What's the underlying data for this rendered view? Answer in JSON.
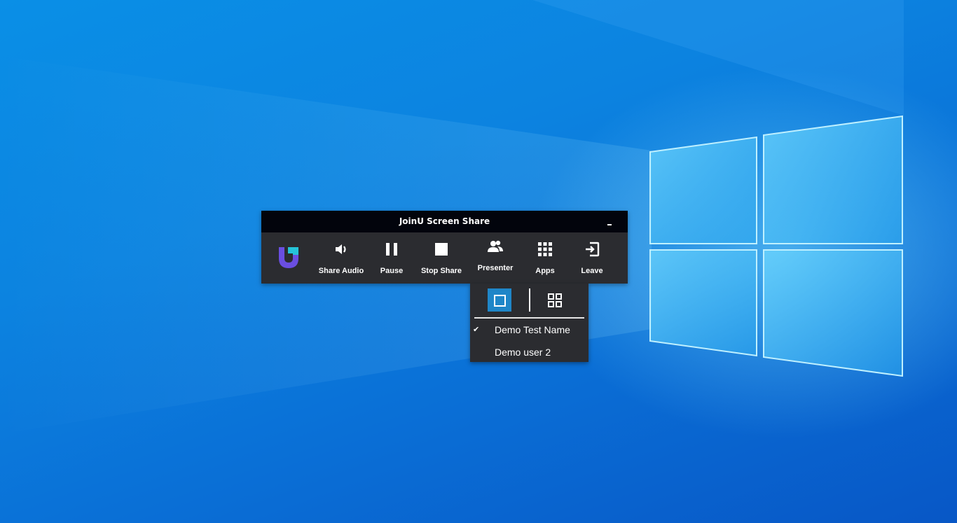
{
  "window": {
    "title": "JoinU Screen Share",
    "minimize_icon": "minimize-icon"
  },
  "toolbar": {
    "logo_icon": "joinu-logo",
    "buttons": [
      {
        "label": "Share Audio",
        "icon": "speaker-icon"
      },
      {
        "label": "Pause",
        "icon": "pause-icon"
      },
      {
        "label": "Stop Share",
        "icon": "stop-icon"
      },
      {
        "label": "Presenter",
        "icon": "people-icon"
      },
      {
        "label": "Apps",
        "icon": "apps-grid-icon"
      },
      {
        "label": "Leave",
        "icon": "exit-icon"
      }
    ]
  },
  "presenter_menu": {
    "layout_options": [
      {
        "icon": "single-view-icon",
        "selected": true
      },
      {
        "icon": "grid-view-icon",
        "selected": false
      }
    ],
    "items": [
      {
        "label": "Demo Test Name",
        "checked": true,
        "check_mark": "✔"
      },
      {
        "label": "Demo user 2",
        "checked": false,
        "check_mark": ""
      }
    ]
  },
  "colors": {
    "desktop_top": "#0a8fe6",
    "desktop_bottom": "#0857c6",
    "titlebar": "#02040c",
    "toolbar_bg": "#2b2c30",
    "selected_layout": "#1f86c8",
    "logo_purple": "#6a4ee0",
    "logo_cyan": "#25c3d8"
  }
}
